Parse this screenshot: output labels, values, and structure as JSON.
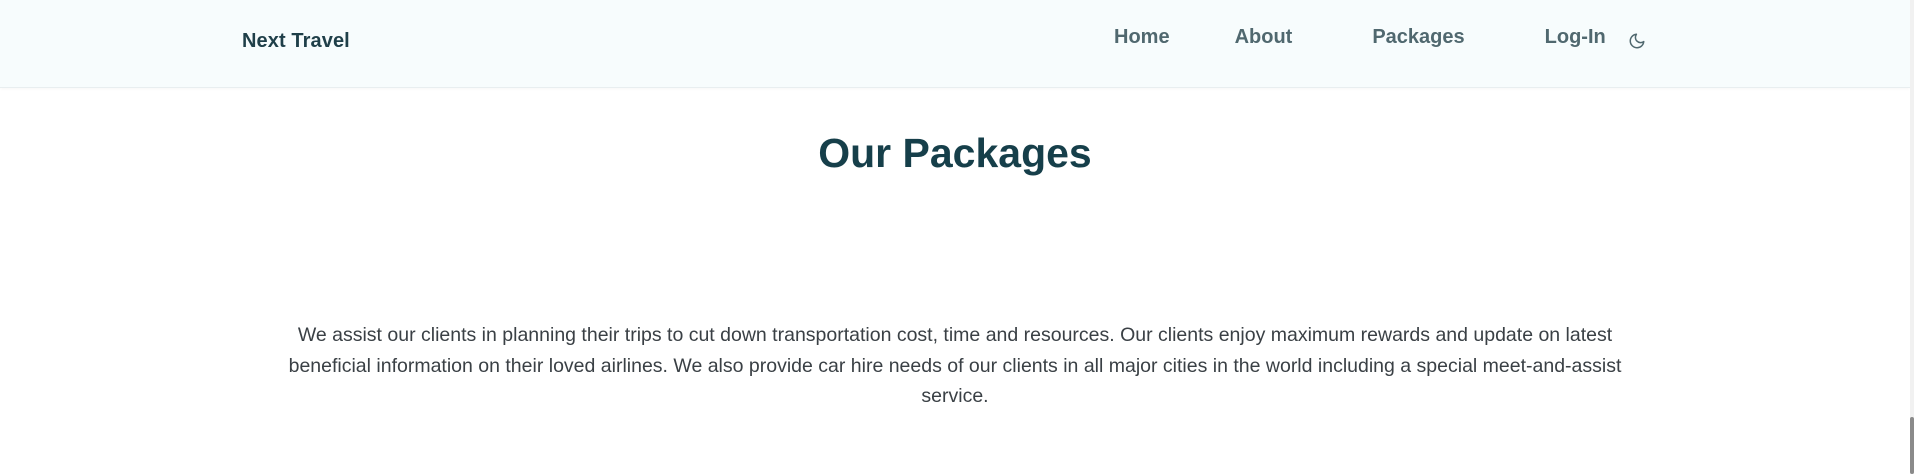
{
  "navbar": {
    "brand": "Next Travel",
    "links": [
      "Home",
      "About",
      "Packages",
      "Log-In"
    ],
    "theme_icon": "moon-icon"
  },
  "main": {
    "heading": "Our Packages",
    "description": "We assist our clients in planning their trips to cut down transportation cost, time and resources. Our clients enjoy maximum rewards and update on latest beneficial information on their loved airlines. We also provide car hire needs of our clients in all major cities in the world including a special meet-and-assist service."
  },
  "colors": {
    "navbar_bg": "#f7fcfd",
    "brand_text": "#1f3f49",
    "nav_text": "#50686f",
    "heading_text": "#163f4a",
    "body_text": "#3a4045"
  }
}
